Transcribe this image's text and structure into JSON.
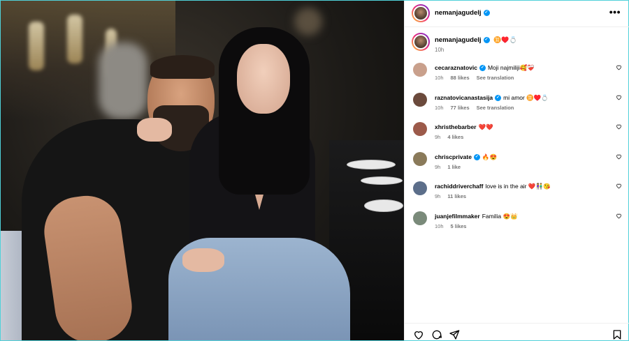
{
  "post": {
    "author": "nemanjagudelj",
    "verified": true,
    "more_icon": "more-horizontal-icon",
    "caption": {
      "username": "nemanjagudelj",
      "text": "♊️♥️💍",
      "time": "10h"
    }
  },
  "comments": [
    {
      "username": "cecaraznatovic",
      "verified": true,
      "text": "Moji najmiliji🥰❤️‍🩹",
      "time": "10h",
      "likes": "88 likes",
      "translation": "See translation",
      "avatar_color": "#c9a08c"
    },
    {
      "username": "raznatovicanastasija",
      "verified": true,
      "text": "mi amor ♊️♥️💍",
      "time": "10h",
      "likes": "77 likes",
      "translation": "See translation",
      "avatar_color": "#6b4a3c"
    },
    {
      "username": "xhristhebarber",
      "verified": false,
      "text": "❤️❤️",
      "time": "9h",
      "likes": "4 likes",
      "translation": "",
      "avatar_color": "#9c5a4a"
    },
    {
      "username": "chriscprivate",
      "verified": true,
      "text": "🔥😍",
      "time": "9h",
      "likes": "1 like",
      "translation": "",
      "avatar_color": "#8a7a5a"
    },
    {
      "username": "rachiddriverchaff",
      "verified": false,
      "text": "love is in the air ❤️👫😘",
      "time": "9h",
      "likes": "11 likes",
      "translation": "",
      "avatar_color": "#5c6e8a"
    },
    {
      "username": "juanjefilmmaker",
      "verified": false,
      "text": "Familia 😍👑",
      "time": "10h",
      "likes": "5 likes",
      "translation": "",
      "avatar_color": "#7a8a7a"
    }
  ],
  "actions": {
    "like_icon": "heart-outline-icon",
    "comment_icon": "comment-icon",
    "share_icon": "send-icon",
    "save_icon": "bookmark-icon"
  },
  "colors": {
    "verified": "#0095f6",
    "muted": "#737373",
    "frame": "#4fd1d9"
  }
}
